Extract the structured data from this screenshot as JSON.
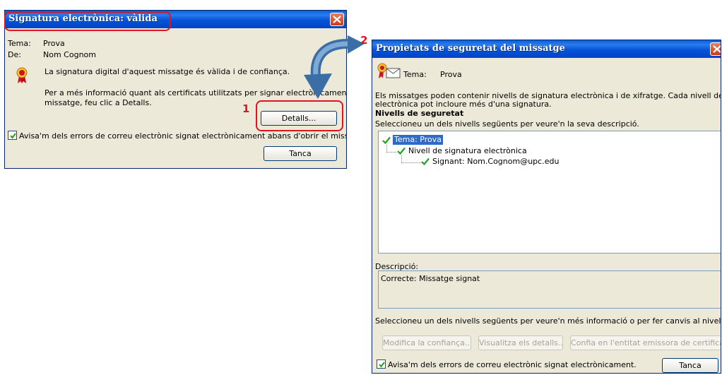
{
  "dialog1": {
    "title": "Signatura electrònica: vàlida",
    "tema_label": "Tema:",
    "tema_value": "Prova",
    "de_label": "De:",
    "de_value": "Nom Cognom",
    "message": "La signatura digital d'aquest missatge és vàlida i de confiança.",
    "info_line1": "Per a més informació quant als certificats utilitzats per signar electrònicament",
    "info_line2": "missatge, feu clic a Detalls.",
    "details_button": "Detalls...",
    "warn_checkbox": "Avisa'm dels errors de correu electrònic signat electrònicament abans d'obrir el missatge.",
    "close_button": "Tanca",
    "step_number": "1"
  },
  "step2_number": "2",
  "dialog2": {
    "title": "Propietats de seguretat del missatge",
    "tema_label": "Tema:",
    "tema_value": "Prova",
    "intro_line1": "Els missatges poden contenir nivells de signatura electrònica i de xifratge. Cada nivell de signatura",
    "intro_line2": "electrònica pot incloure més d'una signatura.",
    "levels_heading": "Nivells de seguretat",
    "levels_instruction": "Seleccioneu un dels nivells següents per veure'n la seva descripció.",
    "tree": [
      "Tema: Prova",
      "Nivell de signatura electrònica",
      "Signant: Nom.Cognom@upc.edu"
    ],
    "description_label": "Descripció:",
    "description_value": "Correcte: Missatge signat",
    "select_instruction": "Seleccioneu un dels nivells següents per veure'n més informació o per fer canvis al nivell seleccionat:",
    "buttons": [
      "Modifica la confiança...",
      "Visualitza els detalls...",
      "Confia en l'entitat emissora de certificats..."
    ],
    "warn_checkbox": "Avisa'm dels errors de correu electrònic signat electrònicament.",
    "close_button": "Tanca"
  },
  "colors": {
    "highlight": "#e0141e",
    "titlebar": "#0553d6",
    "dialog_bg": "#ece9d8",
    "arrow": "#3a6ea5"
  },
  "icons": {
    "certificate": "certificate-ribbon-icon",
    "envelope": "certificate-envelope-icon",
    "close": "close-icon",
    "checkmark": "checkmark-icon",
    "arrow": "curved-arrow-icon"
  }
}
